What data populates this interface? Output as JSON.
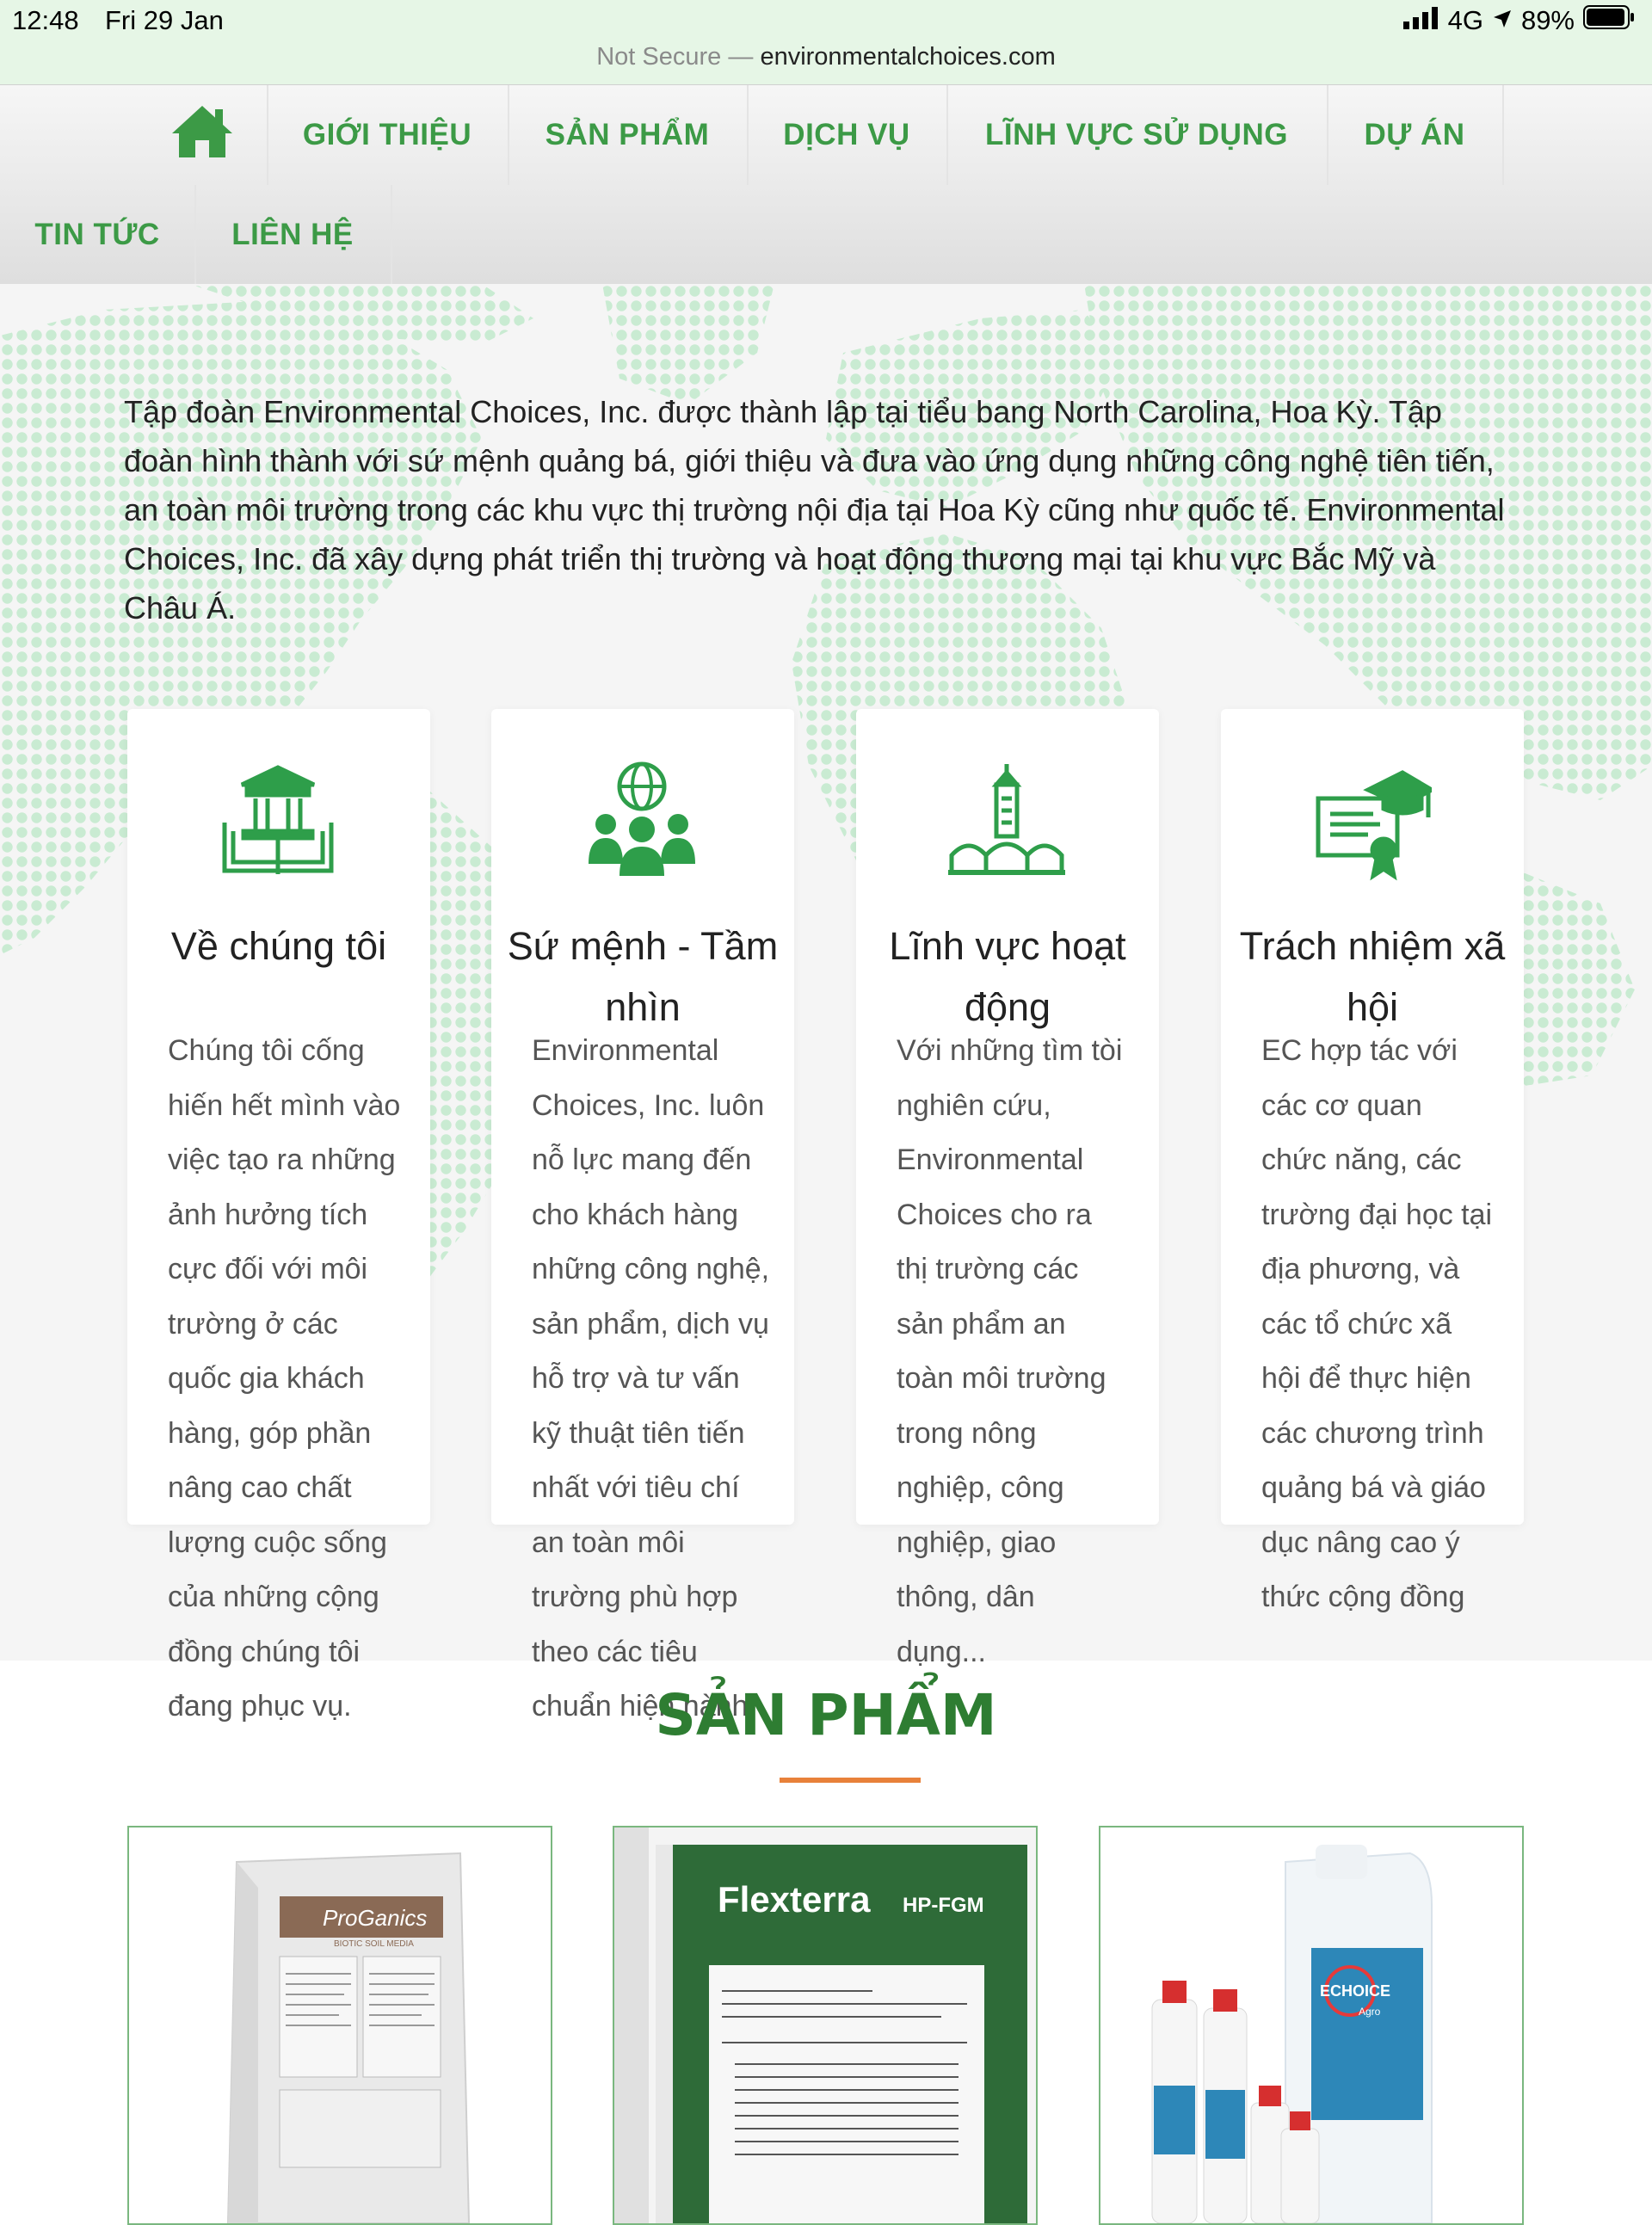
{
  "status_bar": {
    "time": "12:48",
    "date": "Fri 29 Jan",
    "network": "4G",
    "battery": "89%"
  },
  "browser": {
    "security_label": "Not Secure",
    "separator": "—",
    "domain": "environmentalchoices.com"
  },
  "nav": {
    "home_icon": "home-icon",
    "items": [
      "GIỚI THIỆU",
      "SẢN PHẨM",
      "DỊCH VỤ",
      "LĨNH VỰC SỬ DỤNG",
      "DỰ ÁN",
      "TIN TỨC",
      "LIÊN HỆ"
    ]
  },
  "intro": {
    "text": "Tập đoàn Environmental Choices, Inc. được thành lập tại tiểu bang North Carolina, Hoa Kỳ. Tập đoàn hình thành với sứ mệnh quảng bá, giới thiệu và đưa vào ứng dụng những công nghệ tiên tiến, an toàn môi trường trong các khu vực thị trường nội địa tại Hoa Kỳ cũng như quốc tế. Environmental Choices, Inc. đã xây dựng phát triển thị trường và hoạt động thương mại tại khu vực Bắc Mỹ và Châu Á."
  },
  "cards": [
    {
      "icon": "institution-book-icon",
      "title": "Về chúng tôi",
      "text": "Chúng tôi cống hiến hết mình vào việc tạo ra những ảnh hưởng tích cực đối với môi trường ở các quốc gia khách hàng, góp phần nâng cao chất lượng cuộc sống của những cộng đồng chúng tôi đang phục vụ."
    },
    {
      "icon": "globe-people-icon",
      "title": "Sứ mệnh - Tầm nhìn",
      "text": "Environmental Choices, Inc. luôn nỗ lực mang đến cho khách hàng những công nghệ, sản phẩm, dịch vụ hỗ trợ và tư vấn kỹ thuật tiên tiến nhất với tiêu chí an toàn môi trường phù hợp theo các tiêu chuẩn hiện hành."
    },
    {
      "icon": "tower-bridge-icon",
      "title": "Lĩnh vực hoạt động",
      "text": "Với những tìm tòi nghiên cứu, Environmental Choices cho ra thị trường các sản phẩm an toàn môi trường trong nông nghiệp, công nghiệp, giao thông, dân dụng..."
    },
    {
      "icon": "certificate-graduation-icon",
      "title": "Trách nhiệm xã hội",
      "text": "EC hợp tác với các cơ quan chức năng, các trường đại học tại địa phương, và các tổ chức xã hội để thực hiện các chương trình quảng bá và giáo dục nâng cao ý thức cộng đồng"
    }
  ],
  "products": {
    "heading": "SẢN PHẨM",
    "accent_color": "#e8813a",
    "items": [
      {
        "name": "ProGanics",
        "subtitle": "BIOTIC SOIL MEDIA"
      },
      {
        "name": "Flexterra",
        "subtitle": "HP-FGM"
      },
      {
        "name": "ECHOICE",
        "subtitle": "Agro"
      }
    ]
  },
  "colors": {
    "brand_green": "#3c9a46",
    "heading_green": "#2e7d32"
  }
}
